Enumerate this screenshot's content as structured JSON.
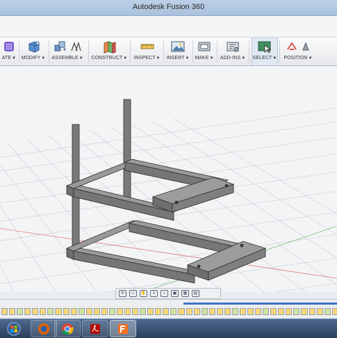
{
  "window": {
    "title": "Autodesk Fusion 360"
  },
  "toolbar": {
    "groups": [
      {
        "label": "ATE",
        "icon": "create-sketch-icon"
      },
      {
        "label": "MODIFY",
        "icon": "modify-icon"
      },
      {
        "label": "ASSEMBLE",
        "icon": "assemble-icon"
      },
      {
        "label": "CONSTRUCT",
        "icon": "construct-plane-icon"
      },
      {
        "label": "INSPECT",
        "icon": "measure-icon"
      },
      {
        "label": "INSERT",
        "icon": "insert-image-icon"
      },
      {
        "label": "MAKE",
        "icon": "print-icon"
      },
      {
        "label": "ADD-INS",
        "icon": "add-ins-icon"
      },
      {
        "label": "SELECT",
        "icon": "select-cursor-icon"
      },
      {
        "label": "POSITION",
        "icon": "position-icon"
      }
    ],
    "caret": "▼"
  },
  "navbar": {
    "tools": [
      "orbit-icon",
      "look-at-icon",
      "pan-icon",
      "zoom-icon",
      "zoom-window-icon",
      "display-settings-icon",
      "grid-settings-icon",
      "viewports-icon"
    ]
  },
  "timeline": {
    "item_count": 44
  },
  "taskbar": {
    "apps": [
      "windows-start-icon",
      "firefox-icon",
      "chrome-icon",
      "acrobat-icon",
      "fusion-360-icon"
    ]
  },
  "colors": {
    "accent": "#3a74c4",
    "model_top": "#8b8b8b",
    "model_side": "#6e6e6e",
    "grid": "#c9ccd1",
    "select_group": "#2e7d4f"
  }
}
